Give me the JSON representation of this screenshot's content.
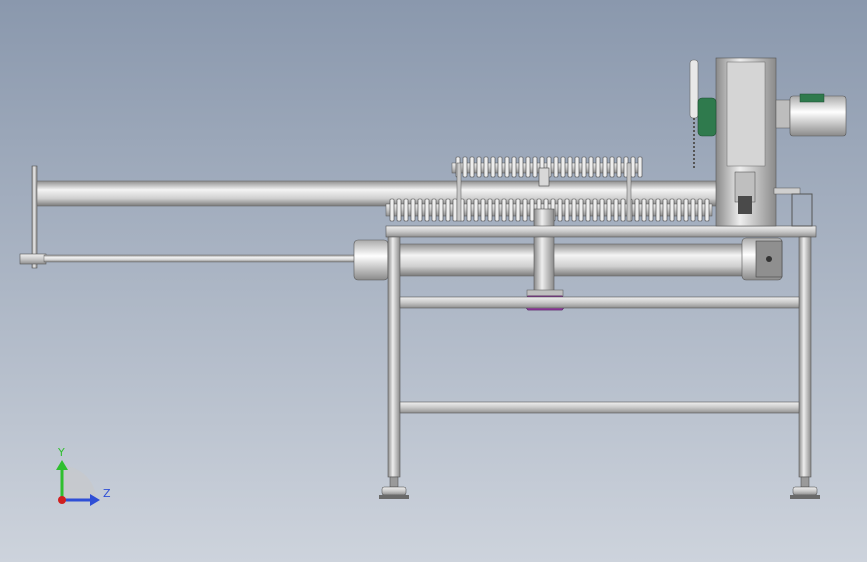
{
  "viewport": {
    "background_top": "#8a98ad",
    "background_bottom": "#cdd3dc"
  },
  "model": {
    "parts": [
      "front-plate",
      "upper-tube",
      "lower-rod",
      "pneumatic-cylinder",
      "roller-assembly",
      "table-top",
      "frame",
      "lift-column",
      "drive-tower",
      "servo-motor",
      "leveling-feet"
    ]
  },
  "triad": {
    "y_label": "Y",
    "z_label": "Z",
    "y_color": "#2fbf2f",
    "z_color": "#2f4fd6",
    "origin_color": "#d02020"
  }
}
